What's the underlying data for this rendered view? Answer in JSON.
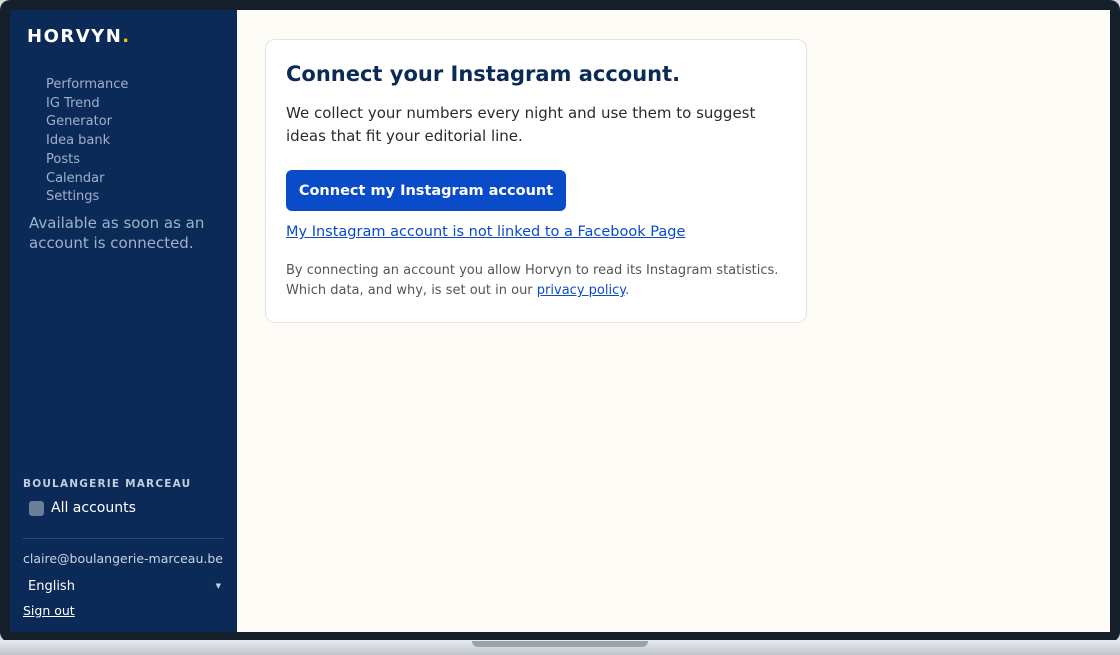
{
  "brand": {
    "name": "HORVYN",
    "dot": ".",
    "dot_color": "#f5c518"
  },
  "sidebar": {
    "nav": [
      {
        "label": "Performance"
      },
      {
        "label": "IG Trend"
      },
      {
        "label": "Generator"
      },
      {
        "label": "Idea bank"
      },
      {
        "label": "Posts"
      },
      {
        "label": "Calendar"
      },
      {
        "label": "Settings"
      }
    ],
    "availability_note": "Available as soon as an account is connected.",
    "workspace_name": "BOULANGERIE MARCEAU",
    "all_accounts_label": "All accounts",
    "user_email": "claire@boulangerie-marceau.be",
    "language": "English",
    "sign_out": "Sign out"
  },
  "main": {
    "title": "Connect your Instagram account.",
    "intro": "We collect your numbers every night and use them to suggest ideas that fit your editorial line.",
    "connect_button": "Connect my Instagram account",
    "not_linked_link": "My Instagram account is not linked to a Facebook Page",
    "consent_text": "By connecting an account you allow Horvyn to read its Instagram statistics. Which data, and why, is set out in our ",
    "privacy_link": "privacy policy",
    "consent_end": "."
  },
  "colors": {
    "sidebar_bg": "#0b2a57",
    "main_bg": "#fdfcf6",
    "accent": "#0a4bc9",
    "title": "#0b2a57"
  },
  "icons": {
    "language_caret": "caret-down-icon"
  }
}
